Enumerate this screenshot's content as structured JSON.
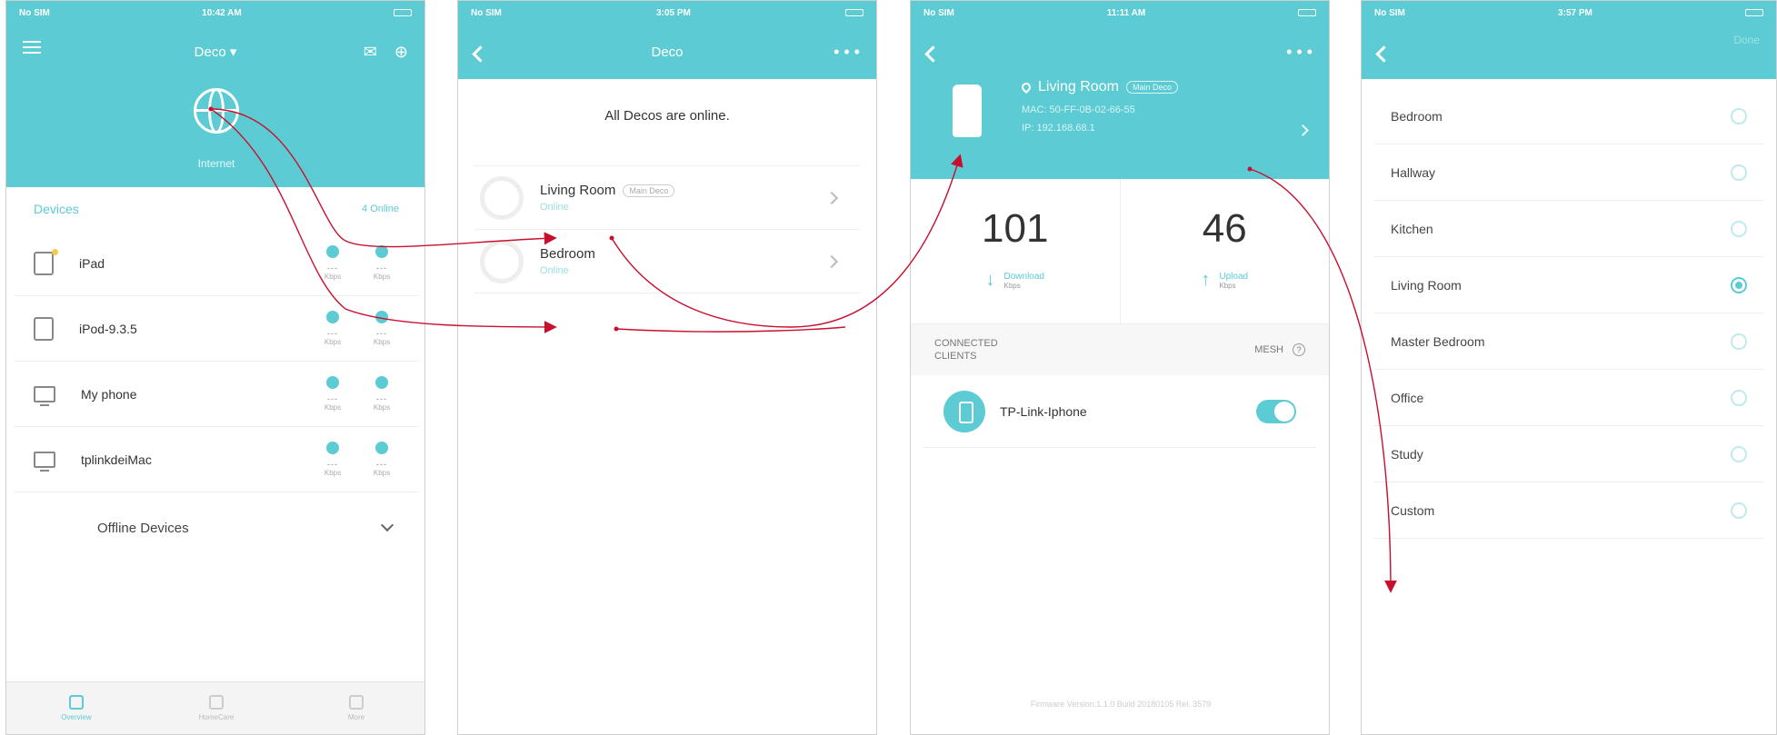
{
  "colors": {
    "accent": "#5ccbd3",
    "arrow": "#c8102e"
  },
  "screen1": {
    "status": {
      "carrier": "No SIM",
      "time": "10:42 AM"
    },
    "nav": {
      "title": "Deco ▾"
    },
    "internet_label": "Internet",
    "devices": {
      "title": "Devices",
      "count": "4 Online",
      "rows": [
        {
          "name": "iPad",
          "icon": "tablet-icon",
          "down": "---",
          "up": "---",
          "down_unit": "Kbps",
          "up_unit": "Kbps"
        },
        {
          "name": "iPod-9.3.5",
          "icon": "phone-icon",
          "down": "---",
          "up": "---",
          "down_unit": "Kbps",
          "up_unit": "Kbps"
        },
        {
          "name": "My phone",
          "icon": "monitor-icon",
          "down": "---",
          "up": "---",
          "down_unit": "Kbps",
          "up_unit": "Kbps"
        },
        {
          "name": "tplinkdeiMac",
          "icon": "monitor-icon",
          "down": "---",
          "up": "---",
          "down_unit": "Kbps",
          "up_unit": "Kbps"
        }
      ],
      "offline_label": "Offline Devices"
    },
    "tabs": [
      "Overview",
      "HomeCare",
      "More"
    ]
  },
  "screen2": {
    "status": {
      "carrier": "No SIM",
      "time": "3:05 PM"
    },
    "nav": {
      "title": "Deco",
      "more": "• • •"
    },
    "message": "All Decos are online.",
    "decos": [
      {
        "name": "Living Room",
        "pill": "Main Deco",
        "status": "Online"
      },
      {
        "name": "Bedroom",
        "pill": "",
        "status": "Online"
      }
    ]
  },
  "screen3": {
    "status": {
      "carrier": "No SIM",
      "time": "11:11 AM"
    },
    "nav": {
      "more": "• • •"
    },
    "deco": {
      "name": "Living Room",
      "pill": "Main Deco",
      "mac": "MAC: 50-FF-0B-02-66-55",
      "ip": "IP: 192.168.68.1"
    },
    "download": {
      "value": "101",
      "label": "Download",
      "unit": "Kbps"
    },
    "upload": {
      "value": "46",
      "label": "Upload",
      "unit": "Kbps"
    },
    "clients_header": "CONNECTED\nCLIENTS",
    "mesh_label": "MESH",
    "clients": [
      {
        "name": "TP-Link-Iphone",
        "enabled": true
      }
    ],
    "firmware": "Firmware Version:1.1.0 Build 20180105 Rel. 3579"
  },
  "screen4": {
    "status": {
      "carrier": "No SIM",
      "time": "3:57 PM"
    },
    "nav": {
      "done": "Done"
    },
    "rooms": [
      {
        "name": "Bedroom",
        "selected": false
      },
      {
        "name": "Hallway",
        "selected": false
      },
      {
        "name": "Kitchen",
        "selected": false
      },
      {
        "name": "Living Room",
        "selected": true
      },
      {
        "name": "Master Bedroom",
        "selected": false
      },
      {
        "name": "Office",
        "selected": false
      },
      {
        "name": "Study",
        "selected": false
      },
      {
        "name": "Custom",
        "selected": false
      }
    ]
  }
}
